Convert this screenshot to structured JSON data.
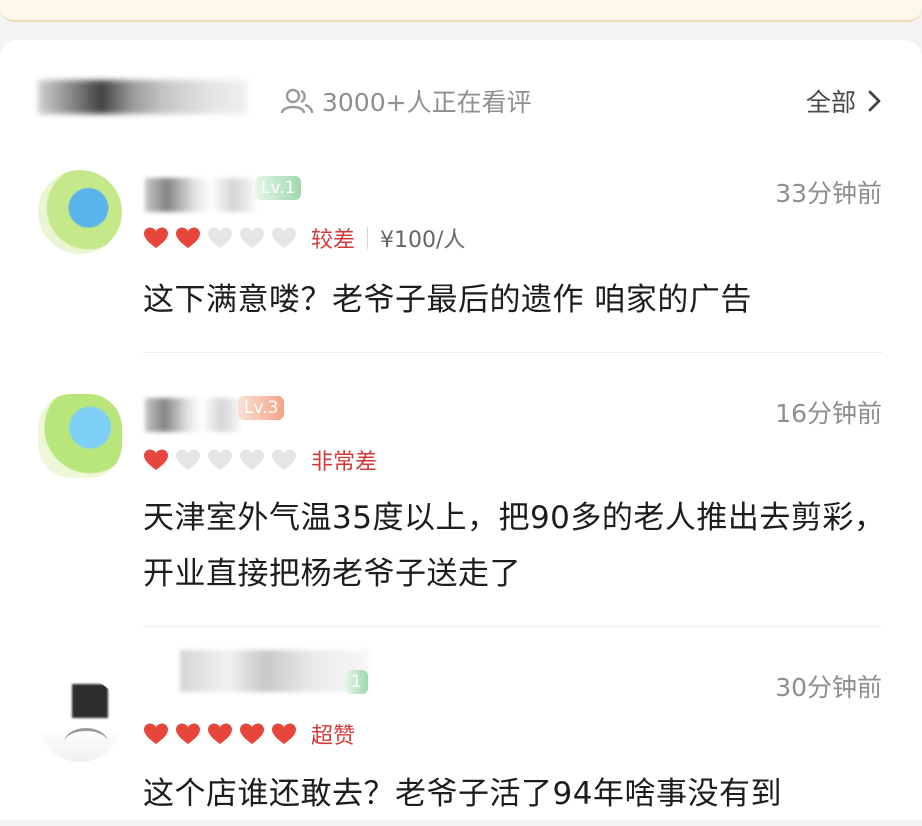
{
  "header": {
    "viewers_text": "3000+人正在看评",
    "all_label": "全部"
  },
  "reviews": [
    {
      "level": "Lv.1",
      "time": "33分钟前",
      "hearts_filled": 2,
      "hearts_total": 5,
      "rating_text": "较差",
      "price": "¥100/人",
      "content": "这下满意喽？老爷子最后的遗作 咱家的广告"
    },
    {
      "level": "Lv.3",
      "time": "16分钟前",
      "hearts_filled": 1,
      "hearts_total": 5,
      "rating_text": "非常差",
      "content": "天津室外气温35度以上，把90多的老人推出去剪彩，开业直接把杨老爷子送走了"
    },
    {
      "level": "1",
      "time": "30分钟前",
      "hearts_filled": 5,
      "hearts_total": 5,
      "rating_text": "超赞",
      "content": "这个店谁还敢去？老爷子活了94年啥事没有到"
    }
  ],
  "colors": {
    "heart_filled": "#e8453c",
    "heart_empty": "#e5e5e5",
    "rating_text": "#d23a3a"
  }
}
